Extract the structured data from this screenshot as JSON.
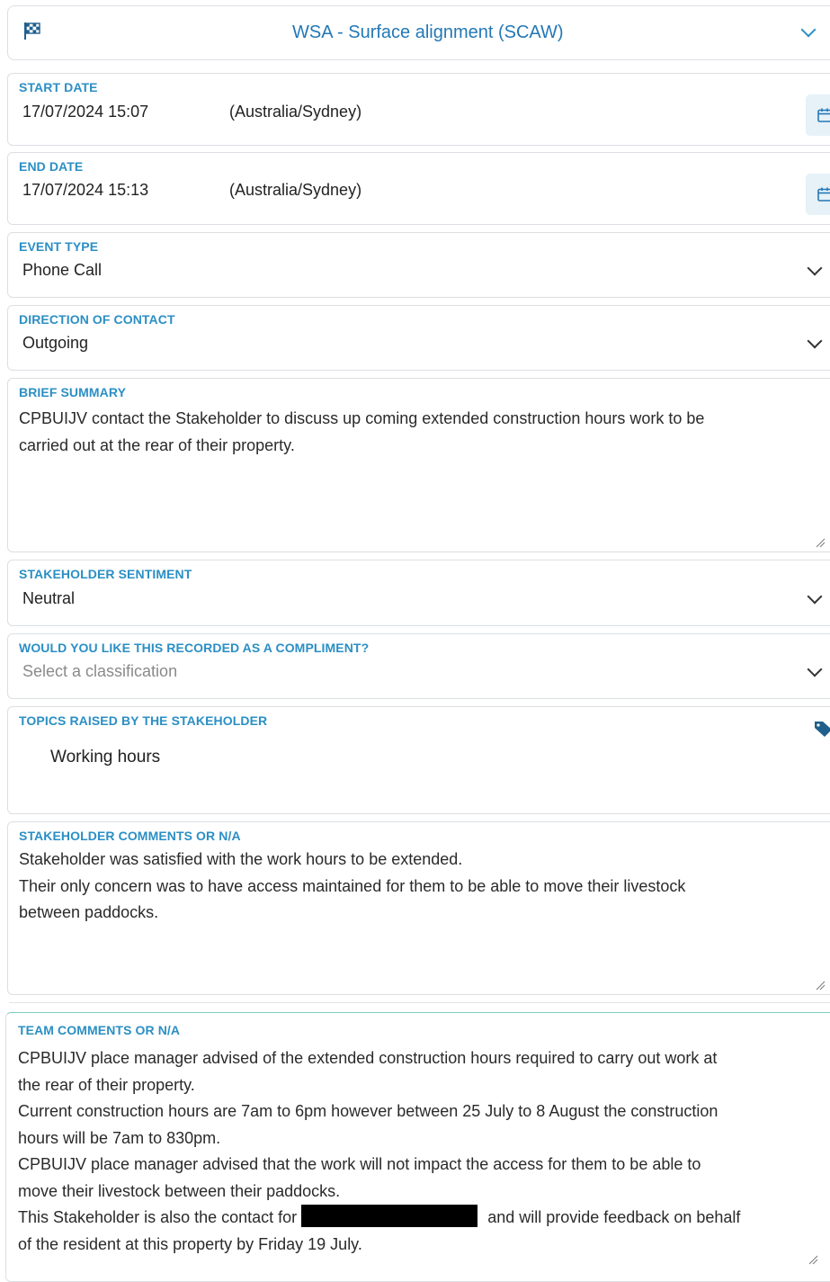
{
  "header": {
    "title": "WSA - Surface alignment (SCAW)",
    "flag_icon": "checkered-flag-icon"
  },
  "start_date": {
    "label": "START DATE",
    "value": "17/07/2024 15:07",
    "timezone": "(Australia/Sydney)"
  },
  "end_date": {
    "label": "END DATE",
    "value": "17/07/2024 15:13",
    "timezone": "(Australia/Sydney)"
  },
  "event_type": {
    "label": "EVENT TYPE",
    "value": "Phone Call"
  },
  "direction": {
    "label": "DIRECTION OF CONTACT",
    "value": "Outgoing"
  },
  "summary": {
    "label": "BRIEF SUMMARY",
    "line1": "CPBUIJV contact the Stakeholder to discuss up coming extended construction hours work to be",
    "line2": "carried out at the rear of their property."
  },
  "sentiment": {
    "label": "STAKEHOLDER SENTIMENT",
    "value": "Neutral"
  },
  "compliment": {
    "label": "WOULD YOU LIKE THIS RECORDED AS A COMPLIMENT?",
    "placeholder": "Select a classification"
  },
  "topics": {
    "label": "TOPICS RAISED BY THE STAKEHOLDER",
    "items": [
      "Working hours"
    ]
  },
  "stakeholder_comments": {
    "label": "STAKEHOLDER COMMENTS OR N/A",
    "line1": "Stakeholder was satisfied with the work hours to be extended.",
    "line2": "Their only concern was to have access maintained for them to be able to move their livestock",
    "line3": "between paddocks."
  },
  "team_comments": {
    "label": "TEAM COMMENTS OR N/A",
    "line1": "CPBUIJV place manager advised of the extended construction hours required to carry out work at",
    "line2": "the rear of their property.",
    "line3": "Current construction hours are 7am to 6pm however between 25 July to 8 August the construction",
    "line4": "hours will be 7am to 830pm.",
    "line5": "CPBUIJV place manager advised that the work will not impact the access for them to be able to",
    "line6": "move their livestock between their paddocks.",
    "line7a": "This Stakeholder is also the contact for",
    "line7b": "and will provide feedback on behalf",
    "line8": "of the resident at this property by Friday 19 July."
  },
  "colors": {
    "label": "#2b8fc4",
    "border": "#dcdfe3",
    "accent_bg": "#e6f1f8"
  }
}
